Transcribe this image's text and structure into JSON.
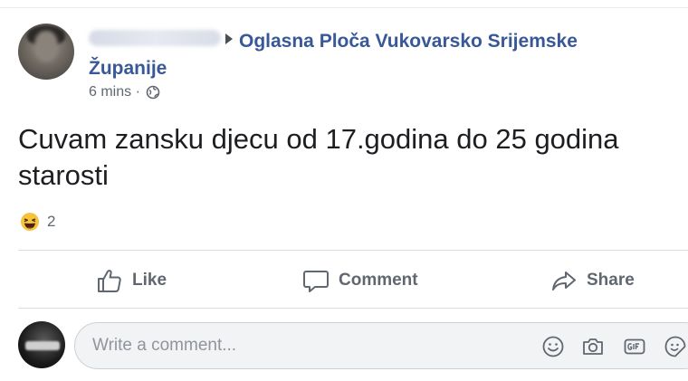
{
  "post": {
    "group_name": "Oglasna Ploča Vukovarsko Srijemske Županije",
    "timestamp": "6 mins ·",
    "audience_icon": "globe-icon",
    "text": "Cuvam zansku djecu od 17.godina do 25 godina starosti",
    "reaction_icon": "haha-icon",
    "reaction_count": "2"
  },
  "actions": {
    "like_label": "Like",
    "comment_label": "Comment",
    "share_label": "Share"
  },
  "composer": {
    "placeholder": "Write a comment...",
    "icons": [
      "emoji-icon",
      "camera-icon",
      "gif-icon",
      "sticker-icon"
    ]
  },
  "colors": {
    "link_blue": "#385898",
    "muted_gray": "#606770",
    "divider": "#dadde1",
    "input_bg": "#f2f3f5"
  }
}
